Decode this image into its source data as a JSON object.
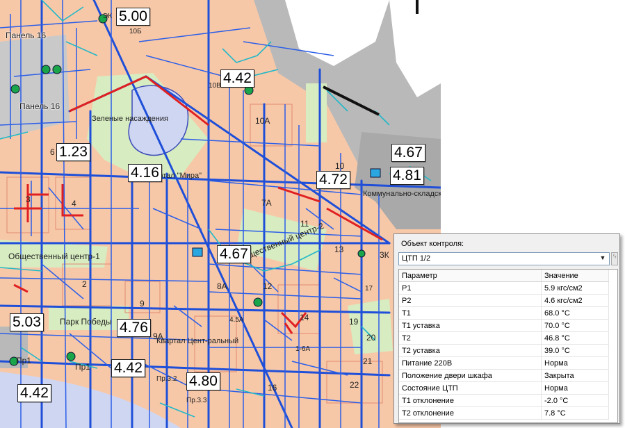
{
  "markers": [
    {
      "id": "m1",
      "value": "5.00"
    },
    {
      "id": "m2",
      "value": "4.42"
    },
    {
      "id": "m3",
      "value": "1.23"
    },
    {
      "id": "m4",
      "value": "4.16"
    },
    {
      "id": "m5",
      "value": "4.67"
    },
    {
      "id": "m6",
      "value": "4.81"
    },
    {
      "id": "m7",
      "value": "4.72"
    },
    {
      "id": "m8",
      "value": "4.67"
    },
    {
      "id": "m9",
      "value": "5.03"
    },
    {
      "id": "m10",
      "value": "4.76"
    },
    {
      "id": "m11",
      "value": "4.42"
    },
    {
      "id": "m12",
      "value": "4.80"
    },
    {
      "id": "m13",
      "value": "4.42"
    }
  ],
  "map_labels": {
    "panel16a": "Панель 16",
    "panel16b": "Панель 16",
    "green": "Зеленые насаждения",
    "kvartal_mira": "Квартал \"Мира\"",
    "komm": "Коммунально-складская зона",
    "obsh2": "Общественный центр-2",
    "obsh1": "Общественный центр-1",
    "park": "Парк Победы",
    "kv_center": "Квартал Цент-ральный",
    "n10b": "10Б",
    "n10v": "10В",
    "n10a": "10А",
    "n10": "10",
    "n7a": "7А",
    "n11": "11",
    "n13": "13",
    "n3k": "3К",
    "n3k_top": "ЭК",
    "n6": "6",
    "n3": "3",
    "n4": "4",
    "n2": "2",
    "n9": "9",
    "n8a": "8А",
    "n12": "12",
    "n14": "14",
    "n19": "19",
    "n20": "20",
    "n21": "21",
    "n22": "22",
    "n16": "16",
    "n4_5a": "4.5А",
    "n9a": "9А",
    "n1_6a": "1-6А",
    "n17": "17",
    "pr1a": "Пр1",
    "pr1b": "Пр1",
    "pr3_2": "Пр.3.2",
    "pr3_3": "Пр.3.3"
  },
  "panel": {
    "object_label": "Объект контроля:",
    "object_value": "ЦТП  1/2",
    "col_param": "Параметр",
    "col_value": "Значение",
    "rows": [
      {
        "param": "P1",
        "value": "5.9 кгс/см2"
      },
      {
        "param": "P2",
        "value": "4.6 кгс/см2"
      },
      {
        "param": "T1",
        "value": "68.0 °C"
      },
      {
        "param": "T1 уставка",
        "value": "70.0 °C"
      },
      {
        "param": "T2",
        "value": "46.8 °C"
      },
      {
        "param": "T2 уставка",
        "value": "39.0 °C"
      },
      {
        "param": "Питание 220В",
        "value": "Норма"
      },
      {
        "param": "Положение двери шкафа",
        "value": "Закрыта"
      },
      {
        "param": "Состояние ЦТП",
        "value": "Норма"
      },
      {
        "param": "T1 отклонение",
        "value": "-2.0 °C"
      },
      {
        "param": "T2 отклонение",
        "value": "7.8 °C"
      }
    ]
  },
  "colors": {
    "pipe_main": "#1f4fd8",
    "pipe_secondary": "#22b8c8",
    "pipe_alert": "#e02020",
    "block_fill": "#f7c8a8",
    "zone_gray": "#b9b9b9",
    "water": "#cfd6f2",
    "green": "#d7ecc0"
  }
}
